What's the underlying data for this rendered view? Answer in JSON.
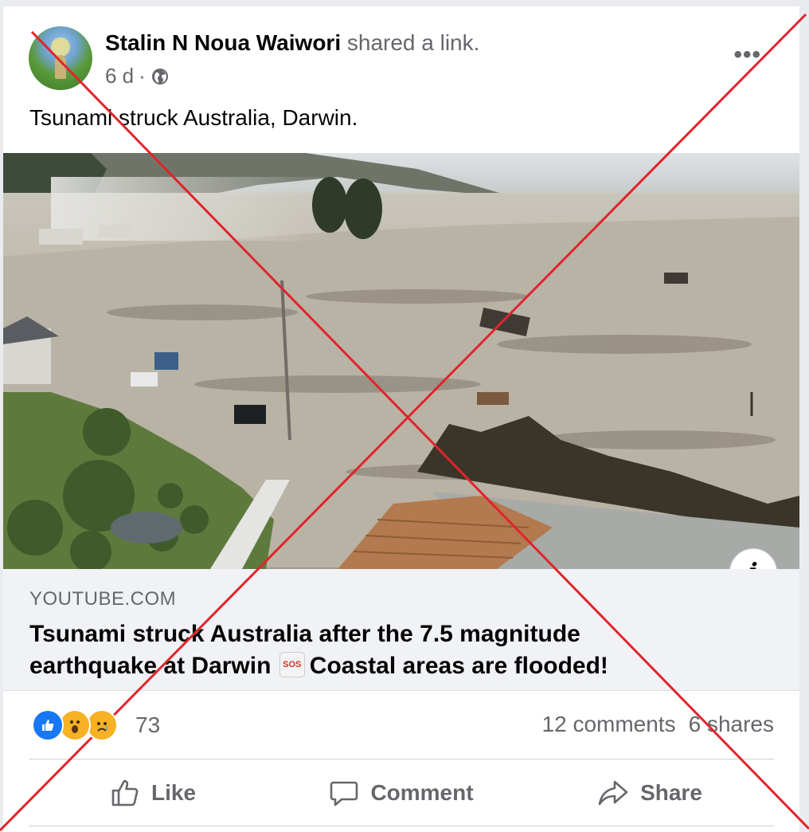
{
  "post": {
    "author": "Stalin N Noua Waiwori",
    "action": "shared a link.",
    "time": "6 d",
    "separator": "·",
    "privacy_icon": "globe-icon",
    "more_icon": "more-options-icon",
    "more_label": "•••",
    "text": "Tsunami struck Australia, Darwin."
  },
  "link": {
    "domain": "YOUTUBE.COM",
    "title_line1": "Tsunami struck Australia after the 7.5 magnitude",
    "title_line2_a": "earthquake at Darwin",
    "sos_label": "SOS",
    "title_line2_b": "Coastal areas are flooded!",
    "info_label": "i"
  },
  "stats": {
    "reactions_count": "73",
    "comments": "12 comments",
    "shares": "6 shares"
  },
  "actions": {
    "like": "Like",
    "comment": "Comment",
    "share": "Share"
  },
  "colors": {
    "overlay_x": "#e0242c",
    "like_blue": "#1877f2",
    "muted_text": "#65676b"
  }
}
